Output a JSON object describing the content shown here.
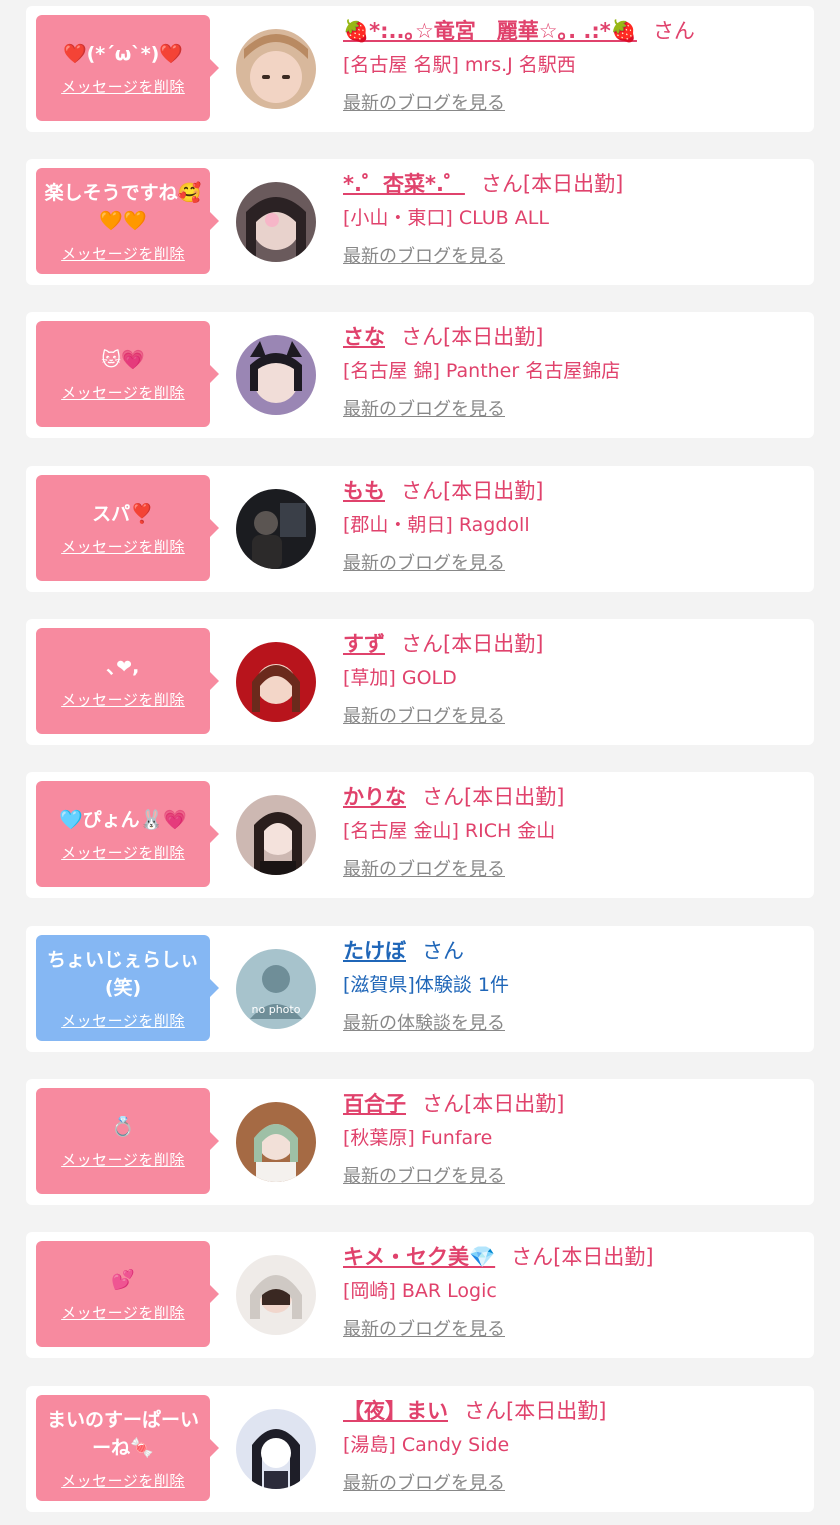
{
  "common": {
    "delete_label": "メッセージを削除",
    "blog_link": "最新のブログを見る"
  },
  "items": [
    {
      "message": "❤️(*´ω`*)❤️",
      "name": "🍓*:..｡☆竜宮　麗華☆｡. .:*🍓",
      "san": "さん",
      "tag": "",
      "shop": "[名古屋 名駅] mrs.J 名駅西",
      "link": "最新のブログを見る"
    },
    {
      "message": "楽しそうですね🥰🧡🧡",
      "name": "*.゜杏菜*.゜",
      "san": "さん",
      "tag": "[本日出勤]",
      "shop": "[小山・東口] CLUB ALL",
      "link": "最新のブログを見る"
    },
    {
      "message": "🐱💗",
      "name": "さな",
      "san": "さん",
      "tag": "[本日出勤]",
      "shop": "[名古屋 錦] Panther 名古屋錦店",
      "link": "最新のブログを見る"
    },
    {
      "message": "スパ❣️",
      "name": "もも",
      "san": "さん",
      "tag": "[本日出勤]",
      "shop": "[郡山・朝日] Ragdoll",
      "link": "最新のブログを見る"
    },
    {
      "message": "､❤︎,",
      "name": "すず",
      "san": "さん",
      "tag": "[本日出勤]",
      "shop": "[草加] GOLD",
      "link": "最新のブログを見る"
    },
    {
      "message": "🩵ぴょん🐰💗",
      "name": "かりな",
      "san": "さん",
      "tag": "[本日出勤]",
      "shop": "[名古屋 金山] RICH 金山",
      "link": "最新のブログを見る"
    },
    {
      "message": "ちょいじぇらしぃ(笑)",
      "name": "たけぼ",
      "san": "さん",
      "tag": "",
      "shop": "[滋賀県]体験談 1件",
      "link": "最新の体験談を見る",
      "avatar_text": "no photo"
    },
    {
      "message": "💍",
      "name": "百合子",
      "san": "さん",
      "tag": "[本日出勤]",
      "shop": "[秋葉原] Funfare",
      "link": "最新のブログを見る"
    },
    {
      "message": "💕",
      "name": "キメ・セク美💎",
      "san": "さん",
      "tag": "[本日出勤]",
      "shop": "[岡崎] BAR Logic",
      "link": "最新のブログを見る"
    },
    {
      "message": "まいのすーぱーいーね🍬",
      "name": "【夜】まい",
      "san": "さん",
      "tag": "[本日出勤]",
      "shop": "[湯島] Candy Side",
      "link": "最新のブログを見る"
    }
  ],
  "colors": {
    "pink_accent": "#e0426c",
    "pink_bubble": "#f78a9f",
    "blue_accent": "#1f66b8",
    "blue_bubble": "#85b7f3",
    "background": "#f3f3f3",
    "link_grey": "#888888"
  }
}
